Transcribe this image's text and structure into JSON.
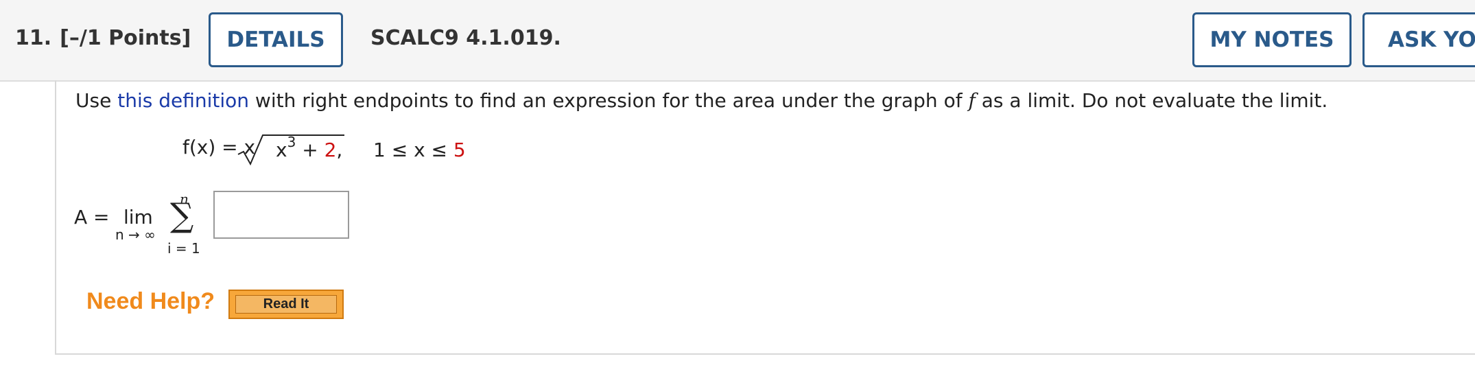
{
  "header": {
    "question_number": "11.",
    "points": "[–/1 Points]",
    "details_label": "DETAILS",
    "question_id": "SCALC9 4.1.019.",
    "my_notes_label": "MY NOTES",
    "ask_label": "ASK YOU"
  },
  "problem": {
    "prompt_before": "Use ",
    "prompt_link": "this definition",
    "prompt_mid": " with right endpoints to find an expression for the area under the graph of ",
    "prompt_var": "f",
    "prompt_after": " as a limit. Do not evaluate the limit.",
    "func_lhs": "f(x) = x",
    "radicand_base": "x",
    "radicand_exp": "3",
    "radicand_plus": " + ",
    "radicand_const": "2",
    "radicand_comma": ",",
    "domain_left": "1 ≤ x ≤ ",
    "domain_right": "5"
  },
  "answer": {
    "a_label": "A =",
    "lim_label": "lim",
    "lim_sub": "n → ∞",
    "sum_upper": "n",
    "sum_symbol": "∑",
    "sum_lower": "i = 1",
    "answer_value": ""
  },
  "help": {
    "need_help_label": "Need Help?",
    "read_it_label": "Read It"
  },
  "colors": {
    "link": "#1a3aa8",
    "accent_red": "#cc1111",
    "button_border": "#2a5a8a",
    "help_orange": "#f08a1c"
  }
}
